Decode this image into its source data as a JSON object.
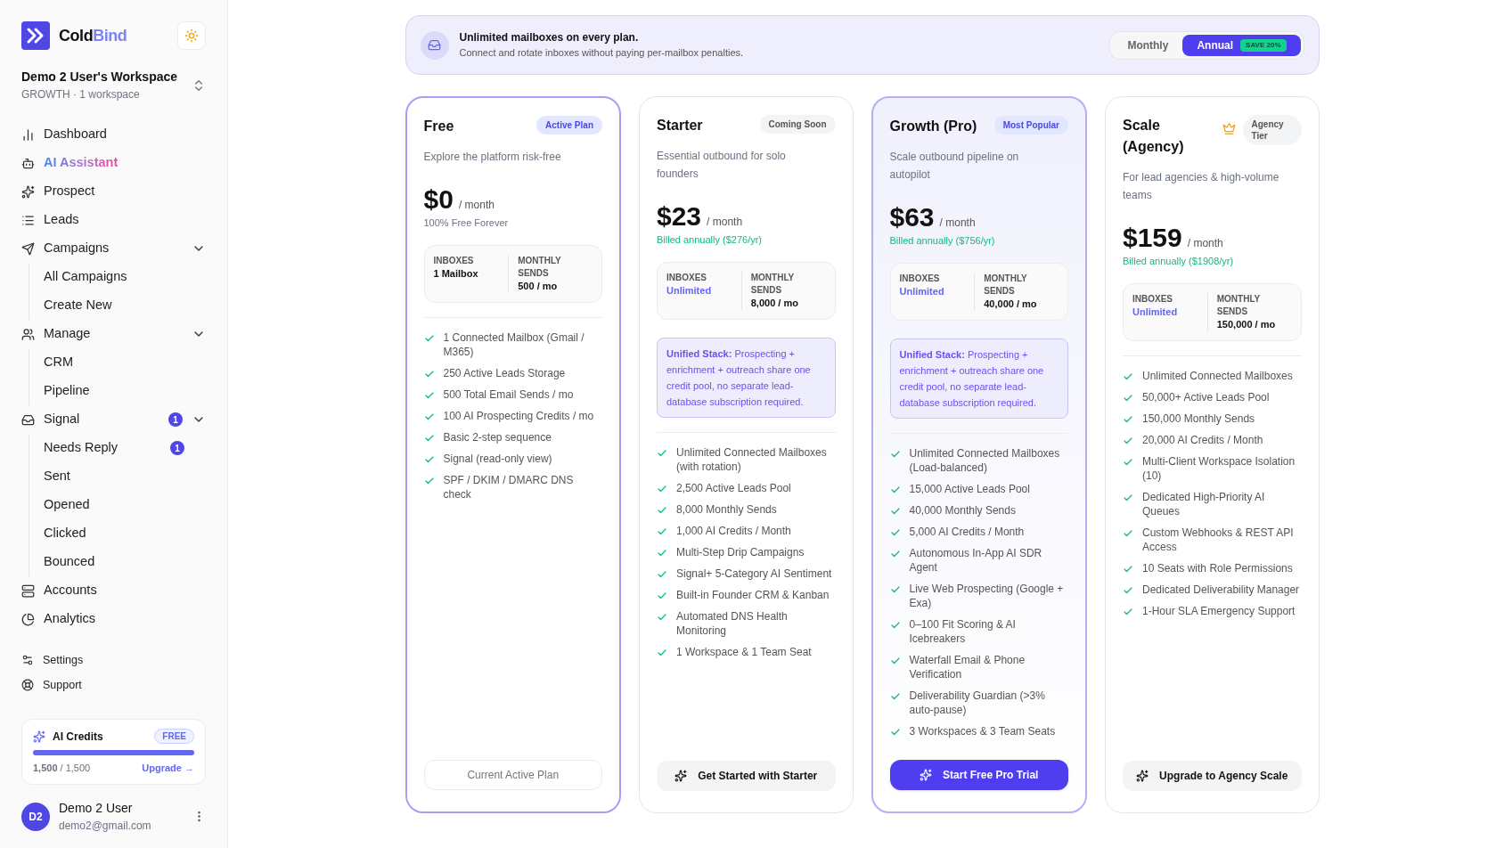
{
  "sidebar": {
    "logo": {
      "first": "Cold",
      "second": "Bind"
    },
    "workspace": {
      "name": "Demo 2 User's Workspace",
      "meta": "GROWTH · 1 workspace"
    },
    "nav": [
      {
        "label": "Dashboard",
        "highlighted": false
      },
      {
        "label": "AI Assistant",
        "highlighted": true
      },
      {
        "label": "Prospect",
        "highlighted": false
      },
      {
        "label": "Leads",
        "highlighted": false
      },
      {
        "label": "Campaigns",
        "highlighted": false,
        "expanded": true,
        "children": [
          {
            "label": "All Campaigns"
          },
          {
            "label": "Create New"
          }
        ]
      },
      {
        "label": "Manage",
        "highlighted": false,
        "expanded": true,
        "children": [
          {
            "label": "CRM"
          },
          {
            "label": "Pipeline"
          }
        ]
      },
      {
        "label": "Signal",
        "highlighted": false,
        "badge": "1",
        "expanded": true,
        "children": [
          {
            "label": "Needs Reply",
            "badge": "1"
          },
          {
            "label": "Sent"
          },
          {
            "label": "Opened"
          },
          {
            "label": "Clicked"
          },
          {
            "label": "Bounced"
          }
        ]
      },
      {
        "label": "Accounts",
        "highlighted": false
      },
      {
        "label": "Analytics",
        "highlighted": false
      }
    ],
    "secondary": [
      {
        "label": "Settings"
      },
      {
        "label": "Support"
      }
    ],
    "credits": {
      "title": "AI Credits",
      "tag": "FREE",
      "level": 1.0,
      "reading": "**1,500** / 1,500",
      "link": "Upgrade →"
    },
    "user": {
      "initials": "D2",
      "name": "Demo 2 User",
      "email": "demo2@gmail.com"
    }
  },
  "banner": {
    "title": "Unlimited mailboxes on every plan.",
    "subtitle": "Connect and rotate inboxes without paying per-mailbox penalties.",
    "billing_options": [
      {
        "label": "Monthly",
        "selected": false
      },
      {
        "label": "Annual",
        "selected": true,
        "tag": "SAVE 20%"
      }
    ]
  },
  "plans": [
    {
      "name": "Free",
      "current": true,
      "popular": false,
      "badge": {
        "label": "Active Plan",
        "kind": "accent"
      },
      "description": "Explore the platform risk-free",
      "price": "$0",
      "period": "/ month",
      "note": {
        "text": "100% Free Forever",
        "kind": "plain"
      },
      "stats": [
        {
          "label": "INBOXES",
          "value": "1 Mailbox",
          "kind": "plain"
        },
        {
          "label": "MONTHLY SENDS",
          "value": "500 / mo",
          "kind": "plain"
        }
      ],
      "features": [
        "1 Connected Mailbox (Gmail / M365)",
        "250 Active Leads Storage",
        "500 Total Email Sends / mo",
        "100 AI Prospecting Credits / mo",
        "Basic 2-step sequence",
        "Signal (read-only view)",
        "SPF / DKIM / DMARC DNS check"
      ],
      "button": {
        "label": "Current Active Plan",
        "kind": "outline"
      }
    },
    {
      "name": "Starter",
      "current": false,
      "popular": false,
      "badge": {
        "label": "Coming Soon",
        "kind": "muted"
      },
      "description": "Essential outbound for solo founders",
      "price": "$23",
      "period": "/ month",
      "note": {
        "text": "Billed annually ($276/yr)",
        "kind": "billing"
      },
      "stats": [
        {
          "label": "INBOXES",
          "value": "Unlimited",
          "kind": "accent"
        },
        {
          "label": "MONTHLY SENDS",
          "value": "8,000 / mo",
          "kind": "plain"
        }
      ],
      "callout": "**Unified Stack:** Prospecting + enrichment + outreach share one credit pool, no separate lead-database subscription required.",
      "features": [
        "Unlimited Connected Mailboxes (with rotation)",
        "2,500 Active Leads Pool",
        "8,000 Monthly Sends",
        "1,000 AI Credits / Month",
        "Multi-Step Drip Campaigns",
        "Signal+ 5-Category AI Sentiment",
        "Built-in Founder CRM & Kanban",
        "Automated DNS Health Monitoring",
        "1 Workspace & 1 Team Seat"
      ],
      "button": {
        "label": "Get Started with Starter",
        "kind": "soft"
      }
    },
    {
      "name": "Growth (Pro)",
      "current": false,
      "popular": true,
      "badge": {
        "label": "Most Popular",
        "kind": "accent"
      },
      "description": "Scale outbound pipeline on autopilot",
      "price": "$63",
      "period": "/ month",
      "note": {
        "text": "Billed annually ($756/yr)",
        "kind": "billing"
      },
      "stats": [
        {
          "label": "INBOXES",
          "value": "Unlimited",
          "kind": "accent"
        },
        {
          "label": "MONTHLY SENDS",
          "value": "40,000 / mo",
          "kind": "plain"
        }
      ],
      "callout": "**Unified Stack:** Prospecting + enrichment + outreach share one credit pool, no separate lead-database subscription required.",
      "features": [
        "Unlimited Connected Mailboxes (Load-balanced)",
        "15,000 Active Leads Pool",
        "40,000 Monthly Sends",
        "5,000 AI Credits / Month",
        "Autonomous In-App AI SDR Agent",
        "Live Web Prospecting (Google + Exa)",
        "0–100 Fit Scoring & AI Icebreakers",
        "Waterfall Email & Phone Verification",
        "Deliverability Guardian (>3% auto-pause)",
        "3 Workspaces & 3 Team Seats"
      ],
      "button": {
        "label": "Start Free Pro Trial",
        "kind": "primary"
      }
    },
    {
      "name": "Scale (Agency)",
      "current": false,
      "popular": false,
      "crown": true,
      "badge": {
        "label": "Agency Tier",
        "kind": "muted"
      },
      "description": "For lead agencies & high-volume teams",
      "price": "$159",
      "period": "/ month",
      "note": {
        "text": "Billed annually ($1908/yr)",
        "kind": "billing"
      },
      "stats": [
        {
          "label": "INBOXES",
          "value": "Unlimited",
          "kind": "accent"
        },
        {
          "label": "MONTHLY SENDS",
          "value": "150,000 / mo",
          "kind": "plain"
        }
      ],
      "features": [
        "Unlimited Connected Mailboxes",
        "50,000+ Active Leads Pool",
        "150,000 Monthly Sends",
        "20,000 AI Credits / Month",
        "Multi-Client Workspace Isolation (10)",
        "Dedicated High-Priority AI Queues",
        "Custom Webhooks & REST API Access",
        "10 Seats with Role Permissions",
        "Dedicated Deliverability Manager",
        "1-Hour SLA Emergency Support"
      ],
      "button": {
        "label": "Upgrade to Agency Scale",
        "kind": "soft"
      }
    }
  ]
}
